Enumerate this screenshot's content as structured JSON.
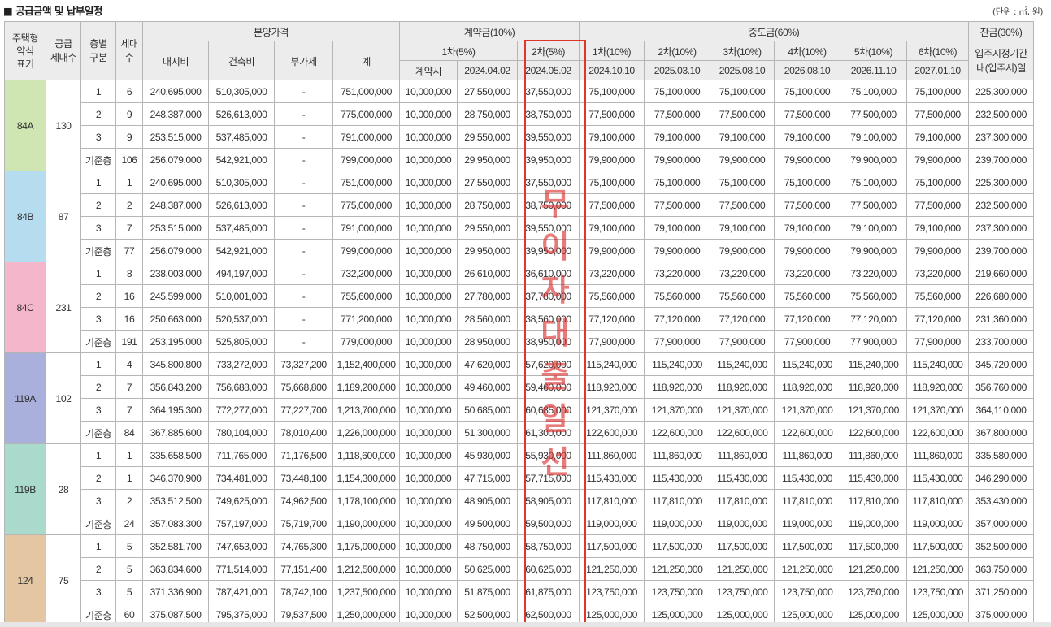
{
  "title": "■ 공급금액 및 납부일정",
  "unit": "(단위 : ㎡, 원)",
  "headers": {
    "type": "주택형\n약식\n표기",
    "supply": "공급\n세대수",
    "floor": "층별\n구분",
    "units": "세대\n수",
    "price_group": "분양가격",
    "land": "대지비",
    "build": "건축비",
    "vat": "부가세",
    "total": "계",
    "deposit": "계약금(10%)",
    "d1": "1차(5%)",
    "d2": "2차(5%)",
    "d_sign": "계약시",
    "d_date1": "2024.04.02",
    "d_date2": "2024.05.02",
    "mid": "중도금(60%)",
    "m": [
      "1차(10%)",
      "2차(10%)",
      "3차(10%)",
      "4차(10%)",
      "5차(10%)",
      "6차(10%)"
    ],
    "m_dates": [
      "2024.10.10",
      "2025.03.10",
      "2025.08.10",
      "2026.08.10",
      "2026.11.10",
      "2027.01.10"
    ],
    "bal": "잔금(30%)",
    "bal_date": "입주지정기간\n내(입주시)일"
  },
  "colors": {
    "84A": "#cfe6b3",
    "84B": "#b6dcef",
    "84C": "#f3b6cb",
    "119A": "#aab0dc",
    "119B": "#a9dacc",
    "124": "#e4c6a3",
    "highlight": "#e0352c"
  },
  "overlay_text": [
    "무",
    "이",
    "자",
    "대",
    "출",
    "알",
    "선"
  ],
  "groups": [
    {
      "type": "84A",
      "supply": "130",
      "rows": [
        [
          "1",
          "6",
          "240,695,000",
          "510,305,000",
          "-",
          "751,000,000",
          "10,000,000",
          "27,550,000",
          "37,550,000",
          "75,100,000",
          "75,100,000",
          "75,100,000",
          "75,100,000",
          "75,100,000",
          "75,100,000",
          "225,300,000"
        ],
        [
          "2",
          "9",
          "248,387,000",
          "526,613,000",
          "-",
          "775,000,000",
          "10,000,000",
          "28,750,000",
          "38,750,000",
          "77,500,000",
          "77,500,000",
          "77,500,000",
          "77,500,000",
          "77,500,000",
          "77,500,000",
          "232,500,000"
        ],
        [
          "3",
          "9",
          "253,515,000",
          "537,485,000",
          "-",
          "791,000,000",
          "10,000,000",
          "29,550,000",
          "39,550,000",
          "79,100,000",
          "79,100,000",
          "79,100,000",
          "79,100,000",
          "79,100,000",
          "79,100,000",
          "237,300,000"
        ],
        [
          "기준층",
          "106",
          "256,079,000",
          "542,921,000",
          "-",
          "799,000,000",
          "10,000,000",
          "29,950,000",
          "39,950,000",
          "79,900,000",
          "79,900,000",
          "79,900,000",
          "79,900,000",
          "79,900,000",
          "79,900,000",
          "239,700,000"
        ]
      ]
    },
    {
      "type": "84B",
      "supply": "87",
      "rows": [
        [
          "1",
          "1",
          "240,695,000",
          "510,305,000",
          "-",
          "751,000,000",
          "10,000,000",
          "27,550,000",
          "37,550,000",
          "75,100,000",
          "75,100,000",
          "75,100,000",
          "75,100,000",
          "75,100,000",
          "75,100,000",
          "225,300,000"
        ],
        [
          "2",
          "2",
          "248,387,000",
          "526,613,000",
          "-",
          "775,000,000",
          "10,000,000",
          "28,750,000",
          "38,750,000",
          "77,500,000",
          "77,500,000",
          "77,500,000",
          "77,500,000",
          "77,500,000",
          "77,500,000",
          "232,500,000"
        ],
        [
          "3",
          "7",
          "253,515,000",
          "537,485,000",
          "-",
          "791,000,000",
          "10,000,000",
          "29,550,000",
          "39,550,000",
          "79,100,000",
          "79,100,000",
          "79,100,000",
          "79,100,000",
          "79,100,000",
          "79,100,000",
          "237,300,000"
        ],
        [
          "기준층",
          "77",
          "256,079,000",
          "542,921,000",
          "-",
          "799,000,000",
          "10,000,000",
          "29,950,000",
          "39,950,000",
          "79,900,000",
          "79,900,000",
          "79,900,000",
          "79,900,000",
          "79,900,000",
          "79,900,000",
          "239,700,000"
        ]
      ]
    },
    {
      "type": "84C",
      "supply": "231",
      "rows": [
        [
          "1",
          "8",
          "238,003,000",
          "494,197,000",
          "-",
          "732,200,000",
          "10,000,000",
          "26,610,000",
          "36,610,000",
          "73,220,000",
          "73,220,000",
          "73,220,000",
          "73,220,000",
          "73,220,000",
          "73,220,000",
          "219,660,000"
        ],
        [
          "2",
          "16",
          "245,599,000",
          "510,001,000",
          "-",
          "755,600,000",
          "10,000,000",
          "27,780,000",
          "37,780,000",
          "75,560,000",
          "75,560,000",
          "75,560,000",
          "75,560,000",
          "75,560,000",
          "75,560,000",
          "226,680,000"
        ],
        [
          "3",
          "16",
          "250,663,000",
          "520,537,000",
          "-",
          "771,200,000",
          "10,000,000",
          "28,560,000",
          "38,560,000",
          "77,120,000",
          "77,120,000",
          "77,120,000",
          "77,120,000",
          "77,120,000",
          "77,120,000",
          "231,360,000"
        ],
        [
          "기준층",
          "191",
          "253,195,000",
          "525,805,000",
          "-",
          "779,000,000",
          "10,000,000",
          "28,950,000",
          "38,950,000",
          "77,900,000",
          "77,900,000",
          "77,900,000",
          "77,900,000",
          "77,900,000",
          "77,900,000",
          "233,700,000"
        ]
      ]
    },
    {
      "type": "119A",
      "supply": "102",
      "rows": [
        [
          "1",
          "4",
          "345,800,800",
          "733,272,000",
          "73,327,200",
          "1,152,400,000",
          "10,000,000",
          "47,620,000",
          "57,620,000",
          "115,240,000",
          "115,240,000",
          "115,240,000",
          "115,240,000",
          "115,240,000",
          "115,240,000",
          "345,720,000"
        ],
        [
          "2",
          "7",
          "356,843,200",
          "756,688,000",
          "75,668,800",
          "1,189,200,000",
          "10,000,000",
          "49,460,000",
          "59,460,000",
          "118,920,000",
          "118,920,000",
          "118,920,000",
          "118,920,000",
          "118,920,000",
          "118,920,000",
          "356,760,000"
        ],
        [
          "3",
          "7",
          "364,195,300",
          "772,277,000",
          "77,227,700",
          "1,213,700,000",
          "10,000,000",
          "50,685,000",
          "60,685,000",
          "121,370,000",
          "121,370,000",
          "121,370,000",
          "121,370,000",
          "121,370,000",
          "121,370,000",
          "364,110,000"
        ],
        [
          "기준층",
          "84",
          "367,885,600",
          "780,104,000",
          "78,010,400",
          "1,226,000,000",
          "10,000,000",
          "51,300,000",
          "61,300,000",
          "122,600,000",
          "122,600,000",
          "122,600,000",
          "122,600,000",
          "122,600,000",
          "122,600,000",
          "367,800,000"
        ]
      ]
    },
    {
      "type": "119B",
      "supply": "28",
      "rows": [
        [
          "1",
          "1",
          "335,658,500",
          "711,765,000",
          "71,176,500",
          "1,118,600,000",
          "10,000,000",
          "45,930,000",
          "55,930,000",
          "111,860,000",
          "111,860,000",
          "111,860,000",
          "111,860,000",
          "111,860,000",
          "111,860,000",
          "335,580,000"
        ],
        [
          "2",
          "1",
          "346,370,900",
          "734,481,000",
          "73,448,100",
          "1,154,300,000",
          "10,000,000",
          "47,715,000",
          "57,715,000",
          "115,430,000",
          "115,430,000",
          "115,430,000",
          "115,430,000",
          "115,430,000",
          "115,430,000",
          "346,290,000"
        ],
        [
          "3",
          "2",
          "353,512,500",
          "749,625,000",
          "74,962,500",
          "1,178,100,000",
          "10,000,000",
          "48,905,000",
          "58,905,000",
          "117,810,000",
          "117,810,000",
          "117,810,000",
          "117,810,000",
          "117,810,000",
          "117,810,000",
          "353,430,000"
        ],
        [
          "기준층",
          "24",
          "357,083,300",
          "757,197,000",
          "75,719,700",
          "1,190,000,000",
          "10,000,000",
          "49,500,000",
          "59,500,000",
          "119,000,000",
          "119,000,000",
          "119,000,000",
          "119,000,000",
          "119,000,000",
          "119,000,000",
          "357,000,000"
        ]
      ]
    },
    {
      "type": "124",
      "supply": "75",
      "rows": [
        [
          "1",
          "5",
          "352,581,700",
          "747,653,000",
          "74,765,300",
          "1,175,000,000",
          "10,000,000",
          "48,750,000",
          "58,750,000",
          "117,500,000",
          "117,500,000",
          "117,500,000",
          "117,500,000",
          "117,500,000",
          "117,500,000",
          "352,500,000"
        ],
        [
          "2",
          "5",
          "363,834,600",
          "771,514,000",
          "77,151,400",
          "1,212,500,000",
          "10,000,000",
          "50,625,000",
          "60,625,000",
          "121,250,000",
          "121,250,000",
          "121,250,000",
          "121,250,000",
          "121,250,000",
          "121,250,000",
          "363,750,000"
        ],
        [
          "3",
          "5",
          "371,336,900",
          "787,421,000",
          "78,742,100",
          "1,237,500,000",
          "10,000,000",
          "51,875,000",
          "61,875,000",
          "123,750,000",
          "123,750,000",
          "123,750,000",
          "123,750,000",
          "123,750,000",
          "123,750,000",
          "371,250,000"
        ],
        [
          "기준층",
          "60",
          "375,087,500",
          "795,375,000",
          "79,537,500",
          "1,250,000,000",
          "10,000,000",
          "52,500,000",
          "62,500,000",
          "125,000,000",
          "125,000,000",
          "125,000,000",
          "125,000,000",
          "125,000,000",
          "125,000,000",
          "375,000,000"
        ]
      ]
    }
  ]
}
